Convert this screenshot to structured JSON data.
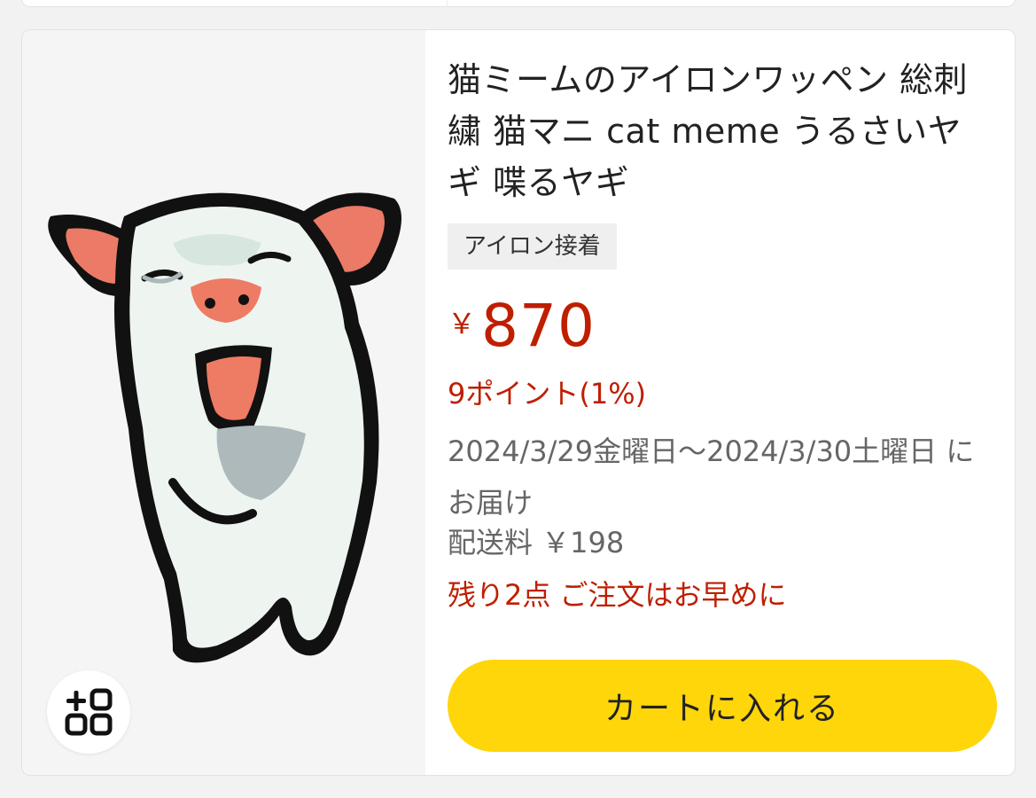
{
  "product": {
    "title": "猫ミームのアイロンワッペン 総刺繍 猫マニ cat meme うるさいヤギ 喋るヤギ",
    "tag": "アイロン接着",
    "price_symbol": "￥",
    "price": "870",
    "points": "9ポイント(1%)",
    "delivery": "2024/3/29金曜日〜2024/3/30土曜日 にお届け",
    "shipping": "配送料 ￥198",
    "stock": "残り2点 ご注文はお早めに",
    "cart_button_label": "カートに入れる"
  },
  "icons": {
    "add_to_list": "add-to-list-icon",
    "product_image": "goat-embroidery-patch"
  },
  "colors": {
    "price_red": "#bf1e00",
    "cart_yellow": "#ffd60a",
    "tag_bg": "#efefef",
    "muted_text": "#666666"
  }
}
